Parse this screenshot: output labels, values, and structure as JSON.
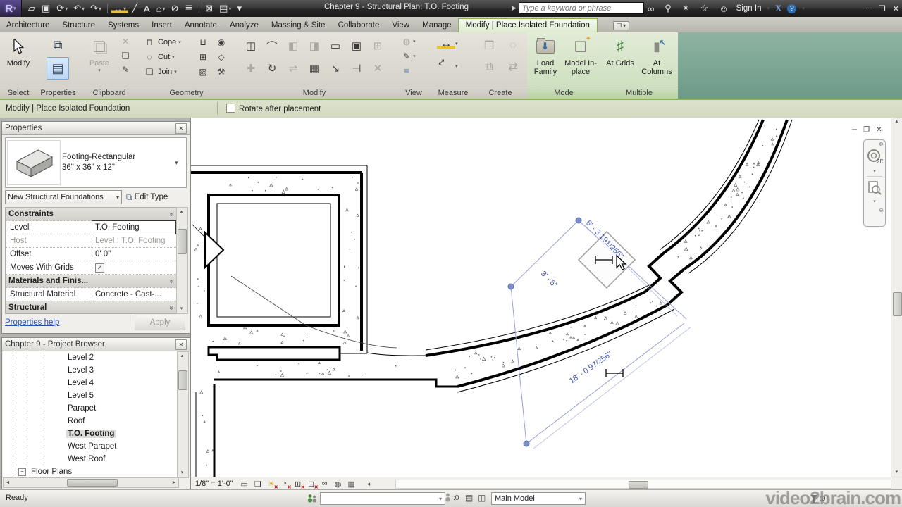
{
  "ui": {
    "close": "✕",
    "caret": "▾",
    "chevron": "«",
    "check": "✓",
    "up": "▴",
    "down": "▾",
    "left": "◄",
    "right": "►",
    "minimize": "─",
    "restore": "❐",
    "circle_close": "⊗",
    "circle_minus": "⊖",
    "back": "◂",
    "search_pre": "▶",
    "panel_toggle_box": "❐"
  },
  "titlebar": {
    "logo_letter": "R",
    "title": "Chapter 9 - Structural Plan: T.O. Footing",
    "search_placeholder": "Type a keyword or phrase",
    "sign_in_label": "Sign In",
    "exchange_label": "X",
    "help_label": "?",
    "qat": [
      {
        "n": "open-icon",
        "g": "▱",
        "c": ""
      },
      {
        "n": "save-icon",
        "g": "▣",
        "c": ""
      },
      {
        "n": "sync-with-central-icon",
        "g": "⟳",
        "c": "▾"
      },
      {
        "n": "undo-icon",
        "g": "↶",
        "c": "▾"
      },
      {
        "n": "redo-icon",
        "g": "↷",
        "c": "▾"
      },
      {
        "n": "qat-separator",
        "g": "",
        "cls": "sep"
      },
      {
        "n": "measure-icon",
        "g": "↔",
        "c": "▾",
        "cls": "gold"
      },
      {
        "n": "aligned-dimension-icon",
        "g": "╱",
        "c": ""
      },
      {
        "n": "text-note-icon",
        "g": "A",
        "c": ""
      },
      {
        "n": "default-3d-view-icon",
        "g": "⌂",
        "c": "▾"
      },
      {
        "n": "section-icon",
        "g": "⊘",
        "c": ""
      },
      {
        "n": "thin-lines-icon",
        "g": "≣",
        "c": ""
      },
      {
        "n": "qat-separator",
        "g": "",
        "cls": "sep"
      },
      {
        "n": "close-inactive-views-icon",
        "g": "⊠",
        "c": ""
      },
      {
        "n": "switch-windows-icon",
        "g": "▤",
        "c": "▾"
      },
      {
        "n": "customize-qat-icon",
        "g": "▾",
        "c": ""
      }
    ],
    "infocenter_icons": [
      {
        "n": "infocenter-search-icon",
        "g": "∞"
      },
      {
        "n": "subscription-center-icon",
        "g": "⚲"
      },
      {
        "n": "communication-center-icon",
        "g": "✴"
      },
      {
        "n": "favorites-icon",
        "g": "☆"
      },
      {
        "n": "signin-user-icon",
        "g": "☺"
      }
    ]
  },
  "tabs": {
    "items": [
      "Architecture",
      "Structure",
      "Systems",
      "Insert",
      "Annotate",
      "Analyze",
      "Massing & Site",
      "Collaborate",
      "View",
      "Manage"
    ],
    "contextual": "Modify | Place Isolated Foundation"
  },
  "ribbon": {
    "select": {
      "label": "Select",
      "modify_label": "Modify"
    },
    "properties_panel": {
      "label": "Properties"
    },
    "clipboard": {
      "label": "Clipboard",
      "paste_label": "Paste",
      "small_icons": [
        {
          "n": "delete-icon",
          "g": "✕",
          "cls": "dis"
        },
        {
          "n": "copy-icon",
          "g": "❑"
        },
        {
          "n": "match-type-icon",
          "g": "✎"
        }
      ]
    },
    "geometry": {
      "label": "Geometry",
      "cope_label": "Cope",
      "cut_label": "Cut",
      "join_label": "Join",
      "row_icons": [
        {
          "n": "cope-icon",
          "g": "⊓"
        },
        {
          "n": "cut-geometry-icon",
          "g": "◌"
        },
        {
          "n": "join-geometry-icon",
          "g": "❏"
        }
      ],
      "extra_icons": [
        {
          "n": "wall-joins-icon",
          "g": "⊔"
        },
        {
          "n": "unjoin-icon",
          "g": "◉"
        },
        {
          "n": "beam-join-icon",
          "g": "⊞"
        },
        {
          "n": "split-face-icon",
          "g": "◇"
        },
        {
          "n": "paint-icon",
          "g": "▨"
        },
        {
          "n": "demolish-icon",
          "g": "⚒"
        }
      ]
    },
    "modify_panel": {
      "label": "Modify",
      "icons_row1": [
        {
          "n": "align-icon",
          "g": "◫"
        },
        {
          "n": "offset-icon",
          "g": "⌒"
        },
        {
          "n": "mirror-axis-icon",
          "g": "◧",
          "cls": "dis"
        },
        {
          "n": "mirror-pick-icon",
          "g": "◨",
          "cls": "dis"
        },
        {
          "n": "split-element-icon",
          "g": "▭"
        },
        {
          "n": "pin-icon",
          "g": "▣"
        },
        {
          "n": "unpin-icon",
          "g": "⊞",
          "cls": "dis"
        }
      ],
      "icons_row2": [
        {
          "n": "move-icon",
          "g": "✚",
          "cls": "dis"
        },
        {
          "n": "rotate-icon",
          "g": "↻"
        },
        {
          "n": "copy-element-icon",
          "g": "⇌",
          "cls": "dis"
        },
        {
          "n": "array-icon",
          "g": "▦"
        },
        {
          "n": "scale-icon",
          "g": "↘"
        },
        {
          "n": "trim-icon",
          "g": "⊣"
        },
        {
          "n": "delete-element-icon",
          "g": "✕",
          "cls": "dis"
        }
      ]
    },
    "view_panel": {
      "label": "View",
      "icons": [
        {
          "n": "hide-elements-icon",
          "g": "◍",
          "cls": "dis",
          "c": "▾"
        },
        {
          "n": "override-graphics-icon",
          "g": "✎",
          "c": "▾"
        },
        {
          "n": "thin-lines-toggle-icon",
          "g": "≡",
          "cls": "blue",
          "c": ""
        }
      ]
    },
    "measure_panel": {
      "label": "Measure",
      "icons": [
        {
          "n": "measure-tape-icon",
          "g": "↔",
          "cls": "gold",
          "c": "▾"
        },
        {
          "n": "measure-between-icon",
          "g": "↕",
          "cls": "rot45",
          "c": "▾"
        }
      ]
    },
    "create_panel": {
      "label": "Create",
      "icons": [
        {
          "n": "create-group-icon",
          "g": "❐",
          "cls": "dis"
        },
        {
          "n": "create-similar-icon",
          "g": "◌",
          "cls": "dis"
        },
        {
          "n": "create-assembly-icon",
          "g": "⧉",
          "cls": "dis"
        },
        {
          "n": "create-parts-icon",
          "g": "⇄",
          "cls": "dis"
        }
      ]
    },
    "mode": {
      "label": "Mode",
      "load_family_label": "Load Family",
      "model_inplace_label": "Model In-place"
    },
    "multiple": {
      "label": "Multiple",
      "at_grids_label": "At Grids",
      "at_columns_label": "At Columns"
    }
  },
  "options_bar": {
    "mode_label": "Modify | Place Isolated Foundation",
    "rotate_label": "Rotate after placement"
  },
  "properties": {
    "title": "Properties",
    "type_name": "Footing-Rectangular",
    "type_size": "36\" x 36\" x 12\"",
    "filter_value": "New Structural Foundations",
    "edit_type_label": "Edit Type",
    "rows": [
      {
        "label": "Constraints"
      },
      {
        "label": "Level",
        "value": "T.O. Footing"
      },
      {
        "label": "Host",
        "value": "Level : T.O. Footing"
      },
      {
        "label": "Offset",
        "value": "0' 0\""
      },
      {
        "label": "Moves With Grids"
      },
      {
        "label": "Materials and Finis..."
      },
      {
        "label": "Structural Material",
        "value": "Concrete - Cast-..."
      },
      {
        "label": "Structural"
      },
      {
        "label": ""
      }
    ],
    "help_label": "Properties help",
    "apply_label": "Apply"
  },
  "browser": {
    "title": "Chapter 9 - Project Browser",
    "items": [
      {
        "label": "Level 2",
        "indent": 74,
        "expander": ""
      },
      {
        "label": "Level 3",
        "indent": 74,
        "expander": ""
      },
      {
        "label": "Level 4",
        "indent": 74,
        "expander": ""
      },
      {
        "label": "Level 5",
        "indent": 74,
        "expander": ""
      },
      {
        "label": "Parapet",
        "indent": 74,
        "expander": ""
      },
      {
        "label": "Roof",
        "indent": 74,
        "expander": ""
      },
      {
        "label": "T.O. Footing",
        "indent": 74,
        "cls": "selected",
        "expander": ""
      },
      {
        "label": "West Parapet",
        "indent": 74,
        "expander": ""
      },
      {
        "label": "West Roof",
        "indent": 74,
        "expander": ""
      },
      {
        "label": "Floor Plans",
        "indent": 22,
        "expander": "−"
      }
    ]
  },
  "canvas": {
    "dim1": "6' - 3 191/256\"",
    "dim2": "3' - 6\"",
    "dim3": "18' - 0 97/256\"",
    "nav_2d_label": "2D"
  },
  "viewbar": {
    "scale": "1/8\" = 1'-0\"",
    "icons": [
      {
        "n": "detail-level-icon",
        "g": "▭"
      },
      {
        "n": "visual-style-icon",
        "g": "❏"
      },
      {
        "n": "sun-path-icon",
        "g": "☀",
        "cls": "gold redx"
      },
      {
        "n": "shadows-icon",
        "g": "◔",
        "cls": "redx"
      },
      {
        "n": "crop-view-icon",
        "g": "⊞",
        "cls": "redx"
      },
      {
        "n": "crop-region-icon",
        "g": "⊡",
        "cls": "redx"
      },
      {
        "n": "temporary-hide-icon",
        "g": "∞"
      },
      {
        "n": "reveal-hidden-icon",
        "g": "◍"
      },
      {
        "n": "analytical-model-icon",
        "g": "▦"
      }
    ]
  },
  "statusbar": {
    "ready": "Ready",
    "active_workset": "",
    "editable_count": ":0",
    "main_model": "Main Model",
    "filter_count": ":0",
    "watermark": "video2brain.com"
  }
}
